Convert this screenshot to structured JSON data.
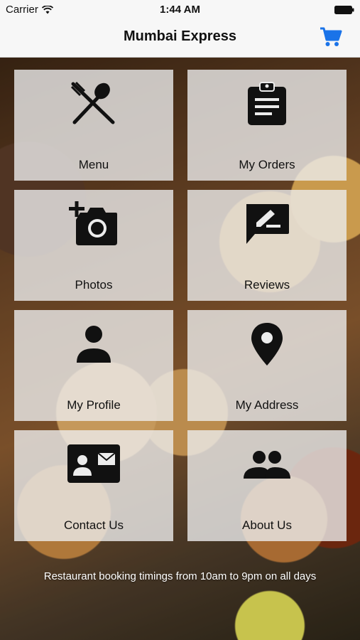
{
  "status": {
    "carrier": "Carrier",
    "time": "1:44 AM"
  },
  "nav": {
    "title": "Mumbai Express",
    "cart_icon": "cart-icon",
    "accent": "#1a73e8"
  },
  "tiles": [
    {
      "label": "Menu",
      "icon": "utensils-icon"
    },
    {
      "label": "My Orders",
      "icon": "clipboard-icon"
    },
    {
      "label": "Photos",
      "icon": "add-photo-icon"
    },
    {
      "label": "Reviews",
      "icon": "review-icon"
    },
    {
      "label": "My Profile",
      "icon": "person-icon"
    },
    {
      "label": "My Address",
      "icon": "location-pin-icon"
    },
    {
      "label": "Contact Us",
      "icon": "contact-card-icon"
    },
    {
      "label": "About Us",
      "icon": "group-icon"
    }
  ],
  "footer": {
    "text": "Restaurant booking timings from 10am to 9pm on all days"
  }
}
